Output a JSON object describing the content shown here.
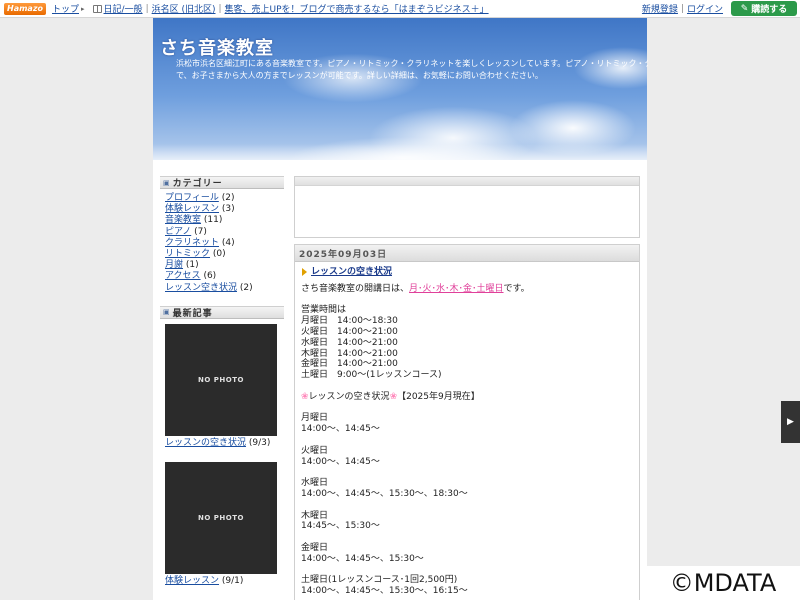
{
  "topbar": {
    "logo": "Hamazo",
    "links": [
      "トップ",
      "日記/一般",
      "浜名区 (旧北区)",
      "集客、売上UPを！ブログで商売するなら「はまぞうビジネス＋」"
    ],
    "register": "新規登録",
    "login": "ログイン",
    "subscribe": "購読する"
  },
  "header": {
    "title": "さち音楽教室",
    "desc_line1": "浜松市浜名区細江町にある音楽教室です。ピアノ・リトミック・クラリネットを楽しくレッスンしています。ピアノ・リトミック・クラリネット・エレクトーン",
    "desc_line2": "で、お子さまから大人の方までレッスンが可能です。詳しい詳細は、お気軽にお問い合わせください。"
  },
  "sidebar": {
    "category_heading": "カテゴリー",
    "categories": [
      {
        "label": "プロフィール",
        "count": "(2)"
      },
      {
        "label": "体験レッスン",
        "count": "(3)"
      },
      {
        "label": "音楽教室",
        "count": "(11)"
      },
      {
        "label": "ピアノ",
        "count": "(7)"
      },
      {
        "label": "クラリネット",
        "count": "(4)"
      },
      {
        "label": "リトミック",
        "count": "(0)"
      },
      {
        "label": "月謝",
        "count": "(1)"
      },
      {
        "label": "アクセス",
        "count": "(6)"
      },
      {
        "label": "レッスン空き状況",
        "count": "(2)"
      }
    ],
    "recent_heading": "最新記事",
    "recent": [
      {
        "photo": "NO PHOTO",
        "label": "レッスンの空き状況",
        "date": "(9/3)"
      },
      {
        "photo": "NO PHOTO",
        "label": "体験レッスン",
        "date": "(9/1)"
      }
    ]
  },
  "entry": {
    "date": "2025年09月03日",
    "title": "レッスンの空き状況",
    "intro_prefix": "さち音楽教室の開講日は、",
    "intro_days": "月･火･水･木･金･土曜日",
    "intro_suffix": "です。",
    "hours_heading": "営業時間は",
    "hours": [
      "月曜日　14:00～18:30",
      "火曜日　14:00～21:00",
      "水曜日　14:00～21:00",
      "木曜日　14:00～21:00",
      "金曜日　14:00～21:00",
      "土曜日　9:00～(1レッスンコース)"
    ],
    "flower": "❀",
    "vacancy_title": "レッスンの空き状況",
    "vacancy_note": "【2025年9月現在】",
    "schedule": [
      {
        "day": "月曜日",
        "times": "14:00～、14:45～"
      },
      {
        "day": "火曜日",
        "times": "14:00～、14:45～"
      },
      {
        "day": "水曜日",
        "times": "14:00～、14:45～、15:30～、18:30～"
      },
      {
        "day": "木曜日",
        "times": "14:45～、15:30～"
      },
      {
        "day": "金曜日",
        "times": "14:00～、14:45～、15:30～"
      },
      {
        "day": "土曜日(1レッスンコース･1回2,500円)",
        "times": "14:00～、14:45～、15:30～、16:15～"
      }
    ]
  },
  "side_tab": "▶",
  "watermark": "©MDATA"
}
